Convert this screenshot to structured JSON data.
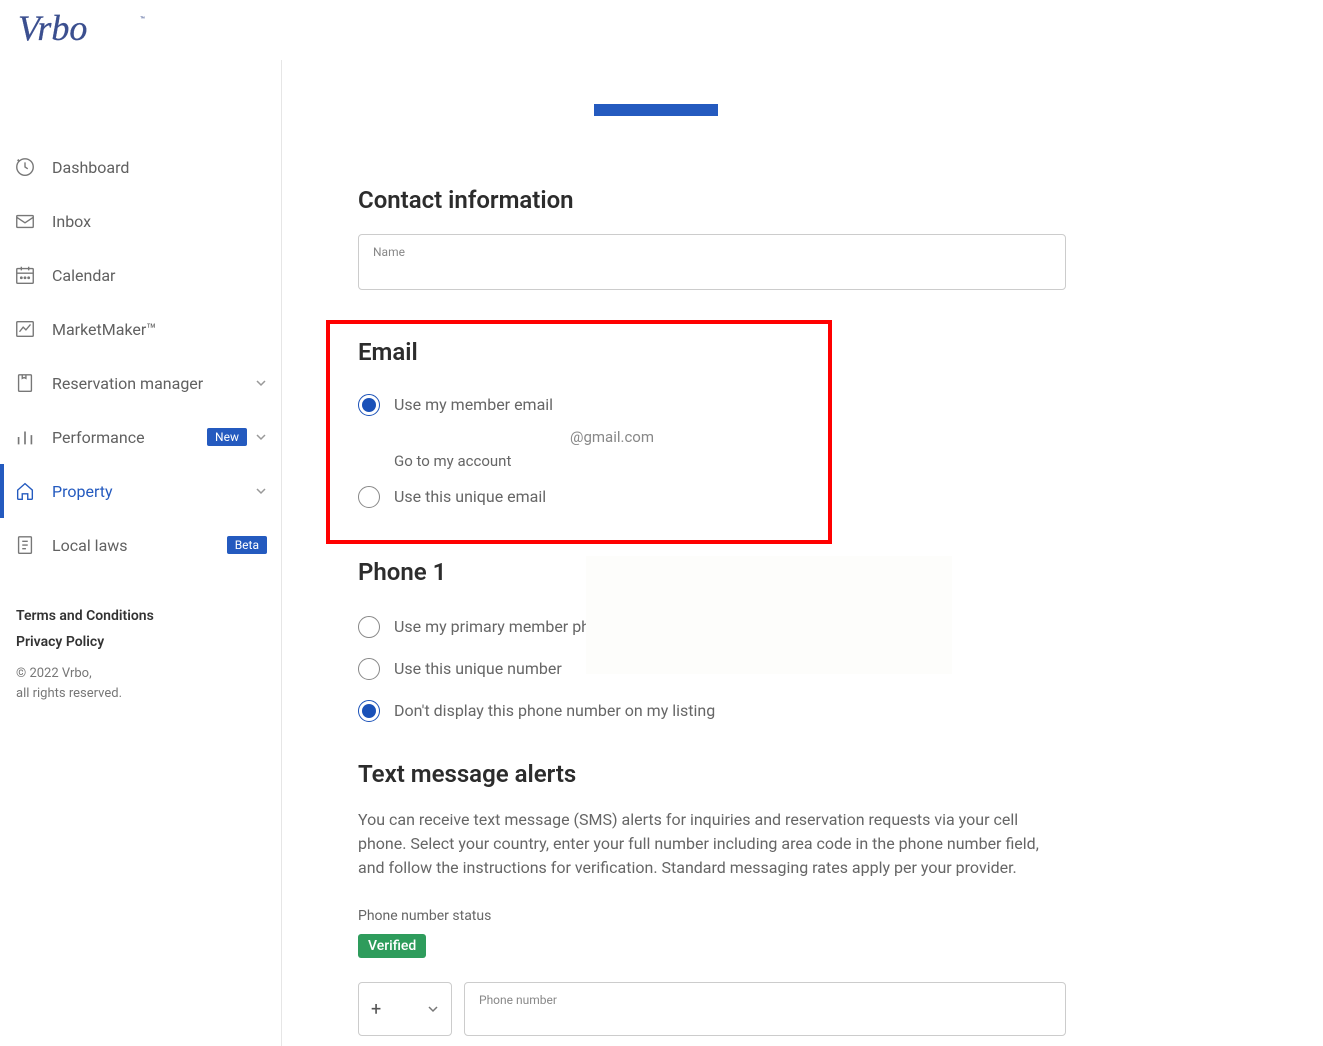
{
  "brand": "Vrbo",
  "sidebar": {
    "items": [
      {
        "label": "Dashboard"
      },
      {
        "label": "Inbox"
      },
      {
        "label": "Calendar"
      },
      {
        "label": "MarketMaker™"
      },
      {
        "label": "Reservation manager"
      },
      {
        "label": "Performance",
        "badge": "New"
      },
      {
        "label": "Property"
      },
      {
        "label": "Local laws",
        "badge_beta": "Beta"
      }
    ],
    "footer": {
      "terms": "Terms and Conditions",
      "privacy": "Privacy Policy",
      "copy1": "© 2022 Vrbo,",
      "copy2": "all rights reserved."
    }
  },
  "contact": {
    "heading": "Contact information",
    "name_label": "Name"
  },
  "email": {
    "heading": "Email",
    "opt1": "Use my member email",
    "display": "@gmail.com",
    "goto": "Go to my account",
    "opt2": "Use this unique email"
  },
  "phone": {
    "heading": "Phone 1",
    "opt1": "Use my primary member phone",
    "opt2": "Use this unique number",
    "opt3": "Don't display this phone number on my listing"
  },
  "sms": {
    "heading": "Text message alerts",
    "body": "You can receive text message (SMS) alerts for inquiries and reservation requests via your cell phone. Select your country, enter your full number including area code in the phone number field, and follow the instructions for verification. Standard messaging rates apply per your provider.",
    "status_label": "Phone number status",
    "verified": "Verified",
    "country_prefix": "+",
    "phone_label": "Phone number"
  }
}
